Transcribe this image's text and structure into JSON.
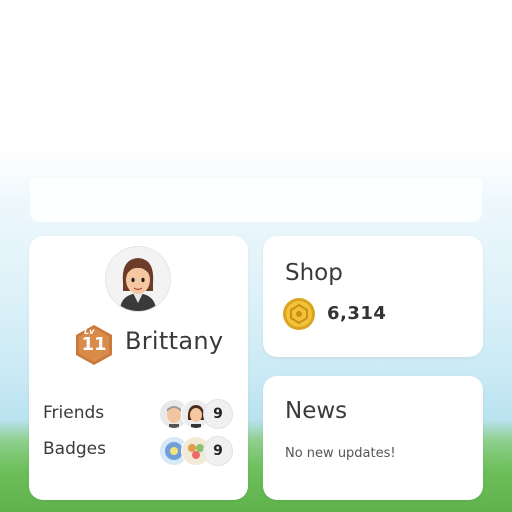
{
  "profile": {
    "name": "Brittany",
    "level_prefix": "Lv",
    "level": "11",
    "friends_label": "Friends",
    "friends_count": "9",
    "badges_label": "Badges",
    "badges_count": "9"
  },
  "shop": {
    "title": "Shop",
    "coins": "6,314",
    "coin_icon": "gold-coin-icon"
  },
  "news": {
    "title": "News",
    "status": "No new updates!"
  },
  "colors": {
    "level_badge": "#c97a3c",
    "coin": "#e8b92a",
    "sky": "#c8e9f4",
    "grass": "#6cbf5a"
  }
}
